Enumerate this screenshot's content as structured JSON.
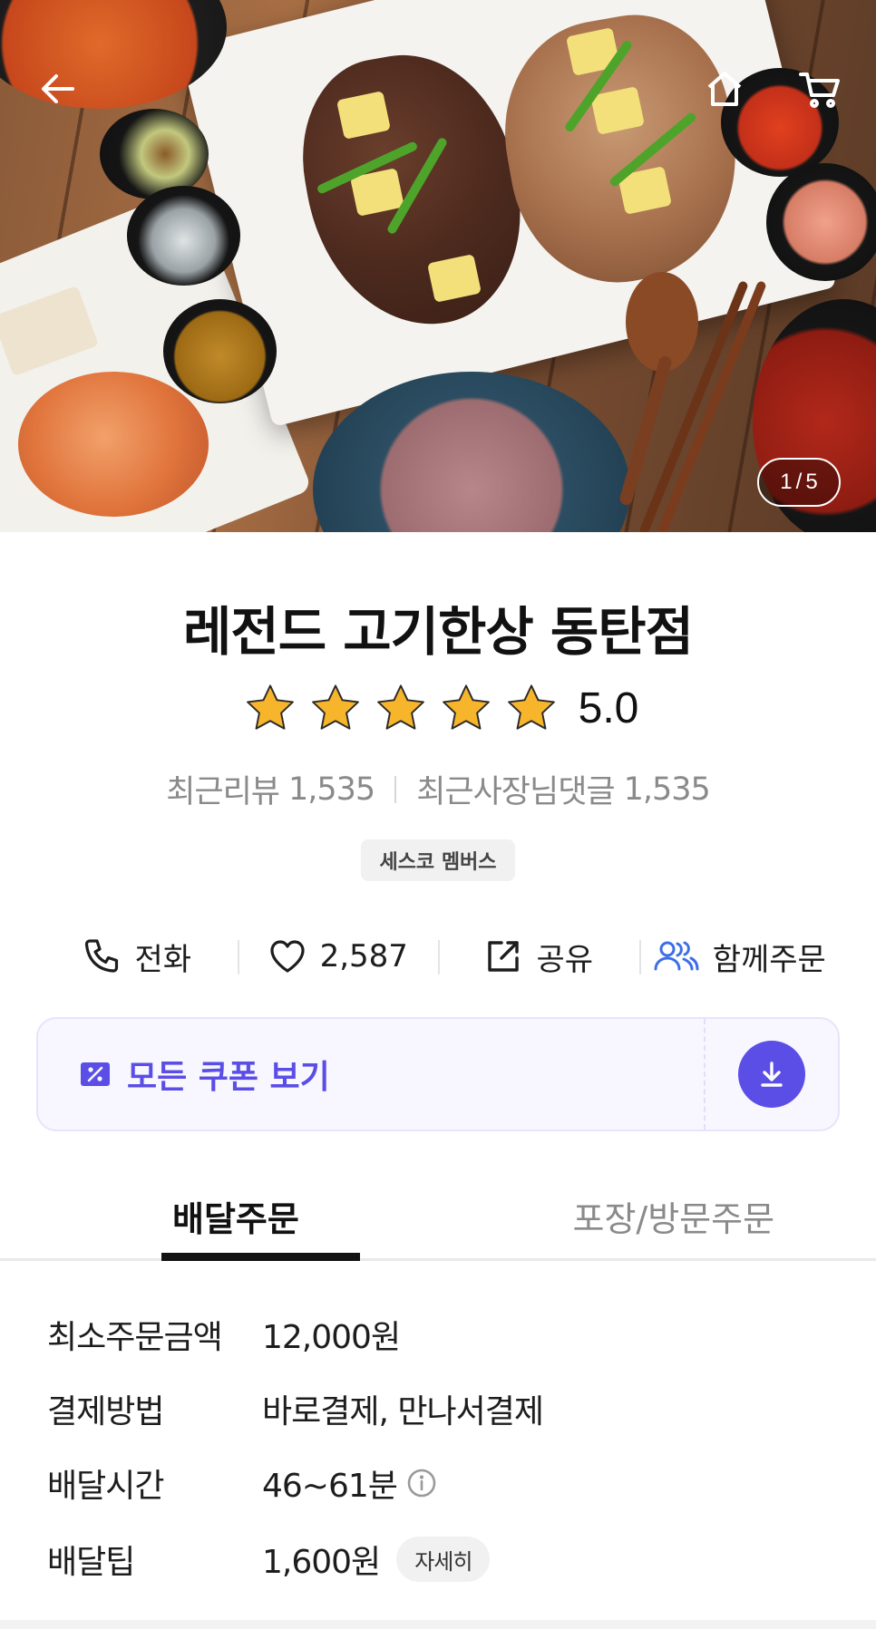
{
  "hero": {
    "pager_current": "1",
    "pager_separator": "/",
    "pager_total": "5"
  },
  "store": {
    "name": "레전드 고기한상 동탄점",
    "rating": "5.0",
    "stars_filled": 5,
    "recent_reviews_label": "최근리뷰",
    "recent_reviews_count": "1,535",
    "owner_replies_label": "최근사장님댓글",
    "owner_replies_count": "1,535",
    "badge": "세스코 멤버스"
  },
  "actions": {
    "call_label": "전화",
    "like_count": "2,587",
    "share_label": "공유",
    "group_order_label": "함께주문"
  },
  "coupon": {
    "label": "모든 쿠폰 보기"
  },
  "tabs": [
    {
      "label": "배달주문",
      "active": true
    },
    {
      "label": "포장/방문주문",
      "active": false
    }
  ],
  "delivery_info": {
    "min_order_label": "최소주문금액",
    "min_order_value": "12,000원",
    "payment_label": "결제방법",
    "payment_value": "바로결제, 만나서결제",
    "time_label": "배달시간",
    "time_value": "46~61분",
    "tip_label": "배달팁",
    "tip_value": "1,600원",
    "tip_detail_button": "자세히"
  },
  "icons": {
    "back": "arrow-left-icon",
    "home": "home-icon",
    "cart": "cart-icon",
    "star": "star-icon",
    "phone": "phone-icon",
    "heart": "heart-icon",
    "share": "share-icon",
    "group": "people-icon",
    "coupon": "coupon-icon",
    "download": "download-icon",
    "info": "info-icon"
  },
  "colors": {
    "accent": "#5b4ee6",
    "star_fill": "#f7b52c",
    "group_icon": "#3d6ee8"
  }
}
